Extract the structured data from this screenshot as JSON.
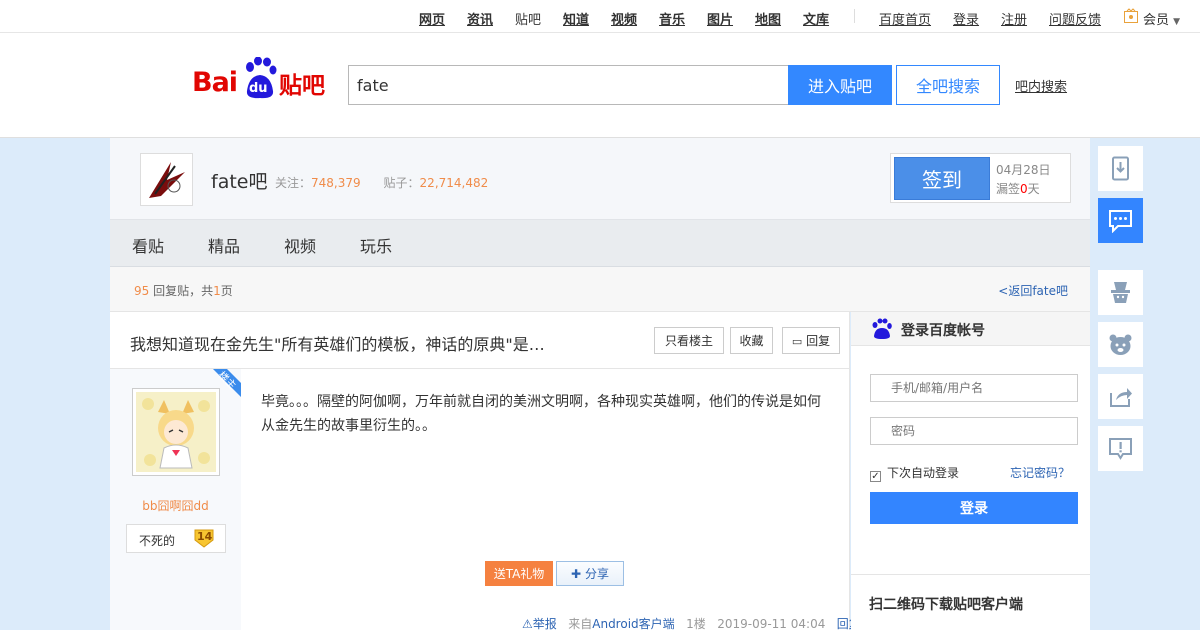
{
  "topnav": {
    "items": [
      "网页",
      "资讯",
      "贴吧",
      "知道",
      "视频",
      "音乐",
      "图片",
      "地图",
      "文库"
    ],
    "right": [
      "百度首页",
      "登录",
      "注册",
      "问题反馈"
    ],
    "member": "会员"
  },
  "header": {
    "search_value": "fate",
    "enter_label": "进入贴吧",
    "all_search_label": "全吧搜索",
    "inbar_label": "吧内搜索"
  },
  "forum": {
    "name": "fate吧",
    "follow_label": "关注：",
    "follow_count": "748,379",
    "posts_label": "贴子：",
    "posts_count": "22,714,482",
    "sign_label": "签到",
    "sign_date": "04月28日",
    "miss_label_a": "漏签",
    "miss_count": "0",
    "miss_label_b": "天"
  },
  "tabs": [
    "看贴",
    "精品",
    "视频",
    "玩乐"
  ],
  "summary": {
    "reply_count": "95",
    "reply_text": "回复贴，共",
    "page_count": "1",
    "page_unit": "页",
    "back_label": "<返回fate吧"
  },
  "post": {
    "title": "我想知道现在金先生\"所有英雄们的模板，神话的原典\"是…",
    "only_op": "只看楼主",
    "collect": "收藏",
    "reply": "回复",
    "op_badge": "楼主",
    "username": "bb囧啊囧dd",
    "level_name": "不死的",
    "level_num": "14",
    "content": "毕竟。。。隔壁的阿伽啊，万年前就自闭的美洲文明啊，各种现实英雄啊，他们的传说是如何从金先生的故事里衍生的。。",
    "gift_label": "送TA礼物",
    "share_label": "分享",
    "report_label": "举报",
    "from_label": "来自",
    "client_label": "Android客户端",
    "floor": "1楼",
    "time": "2019-09-11 04:04",
    "reply_link": "回复"
  },
  "login": {
    "title": "登录百度帐号",
    "user_placeholder": "手机/邮箱/用户名",
    "pwd_placeholder": "密码",
    "remember_label": "下次自动登录",
    "forgot_label": "忘记密码？",
    "login_button": "登录",
    "qr_title": "扫二维码下载贴吧客户端"
  },
  "logo": {
    "text_bai": "Bai",
    "text_du": "du",
    "text_tieba": "贴吧"
  },
  "colors": {
    "accent": "#3388ff",
    "orange": "#f08c4a",
    "link": "#2d64b3",
    "bg_blue": "#dcebfa"
  },
  "tools": [
    "download-app-icon",
    "message-icon",
    "mascot-hat-icon",
    "bear-icon",
    "share-icon",
    "report-icon"
  ]
}
